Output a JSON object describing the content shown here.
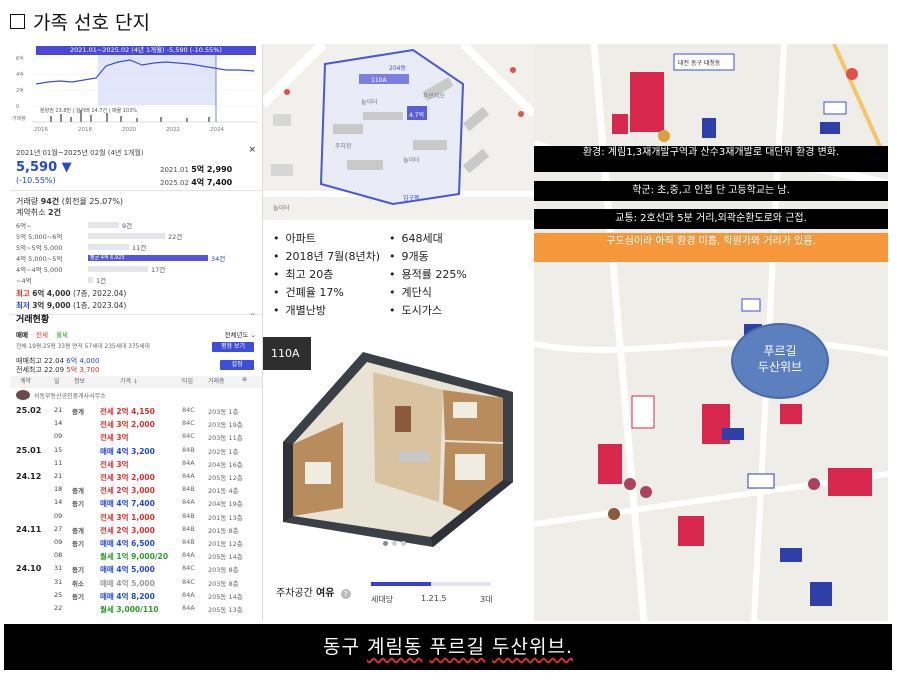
{
  "page_title": "가족 선호 단지",
  "left_panel": {
    "chart_header": "2021.01~2025.02 (4년 1개월) -5,590 (-10.55%)",
    "y_ticks": [
      "6억",
      "4억",
      "2억",
      "0"
    ],
    "x_ticks": [
      "2016",
      "2018",
      "2020",
      "2022",
      "2024"
    ],
    "y_label": "거래량",
    "legend": "분양권 23.8만 | 실거래 14.7건 | 매물 103%",
    "period": "2021년 01월~2025년 02월 (4년 1개월)",
    "close": "×",
    "price": "5,590 ▼",
    "change": "(-10.55%)",
    "range_from_date": "2021.01",
    "range_from_value": "5억 2,990",
    "range_to_date": "2025.02",
    "range_to_value": "4억 7,400",
    "deal_count_label": "거래량",
    "deal_count_value": "94건",
    "deal_count_turnover": "(회전율 25.07%)",
    "cancel_label": "계약취소",
    "cancel_value": "2건",
    "histogram": [
      {
        "label": "6억~",
        "count": "9건",
        "frac": 0.26
      },
      {
        "label": "5억 5,000~6억",
        "count": "22건",
        "frac": 0.64
      },
      {
        "label": "5억~5억 5,000",
        "count": "11건",
        "frac": 0.34
      },
      {
        "label": "4억 5,000~5억",
        "count": "34건",
        "frac": 1.0,
        "hi": "평균 4억 6,923"
      },
      {
        "label": "4억~4억 5,000",
        "count": "17건",
        "frac": 0.5
      },
      {
        "label": "~4억",
        "count": "1건",
        "frac": 0.04
      }
    ],
    "max_label": "최고",
    "max_value": "6억 4,000",
    "max_detail": "(7층, 2022.04)",
    "min_label": "최저",
    "min_value": "3억 9,000",
    "min_detail": "(1층, 2023.04)",
    "section_title": "거래현황",
    "tabs": [
      "매매",
      "전세",
      "월세"
    ],
    "all_years": "전체년도 ⌄",
    "area_row": "전체  19평  25평  33평  면적   57세대  235세대  375세대",
    "btn_recalc": "평형 보기",
    "avg_row1_label": "매매최고 22.04",
    "avg_row1_value": "6억 4,000",
    "avg_row2_label": "전세최고 22.09",
    "avg_row2_value": "5억 3,700",
    "btn_set": "설정",
    "table_headers": [
      "계약",
      "일",
      "정보",
      "가격 ↓",
      "타입",
      "거래층",
      "⊕"
    ],
    "agency": "서동부동산공인중개사사무소",
    "rows": [
      {
        "ym": "25.02",
        "d": "21",
        "info": "중개",
        "price": "전세 2억 4,150",
        "c": "red",
        "type": "84C",
        "floor": "203동 1층"
      },
      {
        "ym": "",
        "d": "14",
        "info": "",
        "price": "전세 3억 2,000",
        "c": "red",
        "type": "84C",
        "floor": "203동 19층"
      },
      {
        "ym": "",
        "d": "09",
        "info": "",
        "price": "전세 3억",
        "c": "red",
        "type": "84C",
        "floor": "203동 11층"
      },
      {
        "ym": "25.01",
        "d": "15",
        "info": "",
        "price": "매매 4억 3,200",
        "c": "blue",
        "type": "84B",
        "floor": "202동 1층"
      },
      {
        "ym": "",
        "d": "11",
        "info": "",
        "price": "전세 3억",
        "c": "red",
        "type": "84A",
        "floor": "204동 16층"
      },
      {
        "ym": "24.12",
        "d": "21",
        "info": "",
        "price": "전세 3억 2,000",
        "c": "red",
        "type": "84A",
        "floor": "205동 12층"
      },
      {
        "ym": "",
        "d": "18",
        "info": "중개",
        "price": "전세 2억 3,000",
        "c": "red",
        "type": "84B",
        "floor": "201동 4층"
      },
      {
        "ym": "",
        "d": "14",
        "info": "등기",
        "price": "매매 4억 7,400",
        "c": "blue",
        "type": "84A",
        "floor": "204동 19층"
      },
      {
        "ym": "",
        "d": "09",
        "info": "",
        "price": "전세 3억 1,000",
        "c": "red",
        "type": "84B",
        "floor": "201동 13층"
      },
      {
        "ym": "24.11",
        "d": "27",
        "info": "중개",
        "price": "전세 2억 3,000",
        "c": "red",
        "type": "84B",
        "floor": "201동 8층"
      },
      {
        "ym": "",
        "d": "09",
        "info": "등기",
        "price": "매매 4억 6,500",
        "c": "blue",
        "type": "84B",
        "floor": "201동 12층"
      },
      {
        "ym": "",
        "d": "08",
        "info": "",
        "price": "월세 1억 9,000/20",
        "c": "green",
        "type": "84A",
        "floor": "205동 14층"
      },
      {
        "ym": "24.10",
        "d": "31",
        "info": "등기",
        "price": "매매 4억 5,000",
        "c": "blue",
        "type": "84C",
        "floor": "203동 8층"
      },
      {
        "ym": "",
        "d": "31",
        "info": "취소",
        "price": "매매 4억 5,000",
        "c": "gray",
        "type": "84C",
        "floor": "203동 8층"
      },
      {
        "ym": "",
        "d": "25",
        "info": "등기",
        "price": "매매 4억 8,200",
        "c": "blue",
        "type": "84A",
        "floor": "205동 14층"
      },
      {
        "ym": "",
        "d": "22",
        "info": "",
        "price": "월세 3,000/110",
        "c": "green",
        "type": "84A",
        "floor": "205동 13층"
      }
    ]
  },
  "middle": {
    "map_labels": [
      "204동",
      "110A",
      "4.7억",
      "놀이터",
      "놀이터",
      "주차장",
      "입구쪽",
      "푸르지오",
      "놀이터"
    ],
    "info_items": [
      "아파트",
      "648세대",
      "2018년 7월(8년차)",
      "9개동",
      "최고 20층",
      "용적률 225%",
      "건폐율 17%",
      "계단식",
      "개별난방",
      "도시가스"
    ],
    "floorplan_badge": "110A",
    "parking_label_a": "주차공간",
    "parking_label_b": "여유",
    "parking_help": "?",
    "parking_fill": 0.5,
    "parking_unit": "세대당",
    "parking_value": "1.21.5",
    "parking_max": "3대"
  },
  "right": {
    "map_top": "대전 동구 대청동",
    "note_env": "환경: 계림1,3재개발구역과 산수3재개발로 대단위 환경 변화.",
    "note_school": "학군: 초,중,고 인접 단 고등학교는 남.",
    "note_traffic": "교통: 2호선과 5분 거리,외곽순환도로와 근접.",
    "note_orange": "구도심이라 아직 환경 미흡, 학원가와 거리가 있음.",
    "bubble_line1": "푸르길",
    "bubble_line2": "두산위브"
  },
  "bottom_title_a": "동구",
  "bottom_title_b": "계림동",
  "bottom_title_c": "푸르길",
  "bottom_title_d": "두산위브."
}
